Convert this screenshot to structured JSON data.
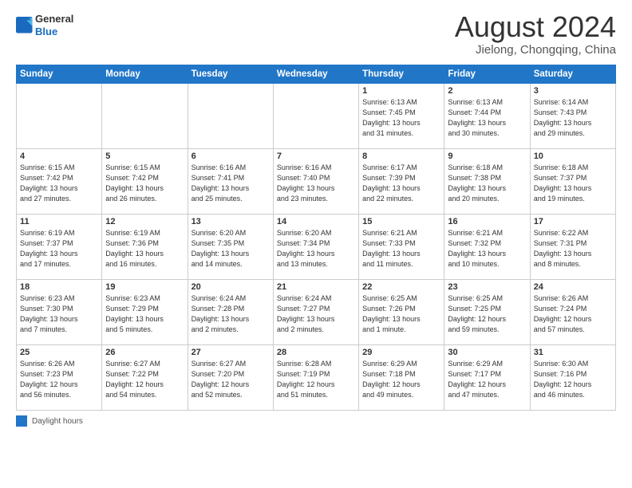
{
  "header": {
    "logo_line1": "General",
    "logo_line2": "Blue",
    "month_title": "August 2024",
    "location": "Jielong, Chongqing, China"
  },
  "days_of_week": [
    "Sunday",
    "Monday",
    "Tuesday",
    "Wednesday",
    "Thursday",
    "Friday",
    "Saturday"
  ],
  "weeks": [
    [
      {
        "day": "",
        "info": ""
      },
      {
        "day": "",
        "info": ""
      },
      {
        "day": "",
        "info": ""
      },
      {
        "day": "",
        "info": ""
      },
      {
        "day": "1",
        "info": "Sunrise: 6:13 AM\nSunset: 7:45 PM\nDaylight: 13 hours\nand 31 minutes."
      },
      {
        "day": "2",
        "info": "Sunrise: 6:13 AM\nSunset: 7:44 PM\nDaylight: 13 hours\nand 30 minutes."
      },
      {
        "day": "3",
        "info": "Sunrise: 6:14 AM\nSunset: 7:43 PM\nDaylight: 13 hours\nand 29 minutes."
      }
    ],
    [
      {
        "day": "4",
        "info": "Sunrise: 6:15 AM\nSunset: 7:42 PM\nDaylight: 13 hours\nand 27 minutes."
      },
      {
        "day": "5",
        "info": "Sunrise: 6:15 AM\nSunset: 7:42 PM\nDaylight: 13 hours\nand 26 minutes."
      },
      {
        "day": "6",
        "info": "Sunrise: 6:16 AM\nSunset: 7:41 PM\nDaylight: 13 hours\nand 25 minutes."
      },
      {
        "day": "7",
        "info": "Sunrise: 6:16 AM\nSunset: 7:40 PM\nDaylight: 13 hours\nand 23 minutes."
      },
      {
        "day": "8",
        "info": "Sunrise: 6:17 AM\nSunset: 7:39 PM\nDaylight: 13 hours\nand 22 minutes."
      },
      {
        "day": "9",
        "info": "Sunrise: 6:18 AM\nSunset: 7:38 PM\nDaylight: 13 hours\nand 20 minutes."
      },
      {
        "day": "10",
        "info": "Sunrise: 6:18 AM\nSunset: 7:37 PM\nDaylight: 13 hours\nand 19 minutes."
      }
    ],
    [
      {
        "day": "11",
        "info": "Sunrise: 6:19 AM\nSunset: 7:37 PM\nDaylight: 13 hours\nand 17 minutes."
      },
      {
        "day": "12",
        "info": "Sunrise: 6:19 AM\nSunset: 7:36 PM\nDaylight: 13 hours\nand 16 minutes."
      },
      {
        "day": "13",
        "info": "Sunrise: 6:20 AM\nSunset: 7:35 PM\nDaylight: 13 hours\nand 14 minutes."
      },
      {
        "day": "14",
        "info": "Sunrise: 6:20 AM\nSunset: 7:34 PM\nDaylight: 13 hours\nand 13 minutes."
      },
      {
        "day": "15",
        "info": "Sunrise: 6:21 AM\nSunset: 7:33 PM\nDaylight: 13 hours\nand 11 minutes."
      },
      {
        "day": "16",
        "info": "Sunrise: 6:21 AM\nSunset: 7:32 PM\nDaylight: 13 hours\nand 10 minutes."
      },
      {
        "day": "17",
        "info": "Sunrise: 6:22 AM\nSunset: 7:31 PM\nDaylight: 13 hours\nand 8 minutes."
      }
    ],
    [
      {
        "day": "18",
        "info": "Sunrise: 6:23 AM\nSunset: 7:30 PM\nDaylight: 13 hours\nand 7 minutes."
      },
      {
        "day": "19",
        "info": "Sunrise: 6:23 AM\nSunset: 7:29 PM\nDaylight: 13 hours\nand 5 minutes."
      },
      {
        "day": "20",
        "info": "Sunrise: 6:24 AM\nSunset: 7:28 PM\nDaylight: 13 hours\nand 2 minutes."
      },
      {
        "day": "21",
        "info": "Sunrise: 6:24 AM\nSunset: 7:27 PM\nDaylight: 13 hours\nand 2 minutes."
      },
      {
        "day": "22",
        "info": "Sunrise: 6:25 AM\nSunset: 7:26 PM\nDaylight: 13 hours\nand 1 minute."
      },
      {
        "day": "23",
        "info": "Sunrise: 6:25 AM\nSunset: 7:25 PM\nDaylight: 12 hours\nand 59 minutes."
      },
      {
        "day": "24",
        "info": "Sunrise: 6:26 AM\nSunset: 7:24 PM\nDaylight: 12 hours\nand 57 minutes."
      }
    ],
    [
      {
        "day": "25",
        "info": "Sunrise: 6:26 AM\nSunset: 7:23 PM\nDaylight: 12 hours\nand 56 minutes."
      },
      {
        "day": "26",
        "info": "Sunrise: 6:27 AM\nSunset: 7:22 PM\nDaylight: 12 hours\nand 54 minutes."
      },
      {
        "day": "27",
        "info": "Sunrise: 6:27 AM\nSunset: 7:20 PM\nDaylight: 12 hours\nand 52 minutes."
      },
      {
        "day": "28",
        "info": "Sunrise: 6:28 AM\nSunset: 7:19 PM\nDaylight: 12 hours\nand 51 minutes."
      },
      {
        "day": "29",
        "info": "Sunrise: 6:29 AM\nSunset: 7:18 PM\nDaylight: 12 hours\nand 49 minutes."
      },
      {
        "day": "30",
        "info": "Sunrise: 6:29 AM\nSunset: 7:17 PM\nDaylight: 12 hours\nand 47 minutes."
      },
      {
        "day": "31",
        "info": "Sunrise: 6:30 AM\nSunset: 7:16 PM\nDaylight: 12 hours\nand 46 minutes."
      }
    ]
  ],
  "legend": {
    "label": "Daylight hours"
  }
}
